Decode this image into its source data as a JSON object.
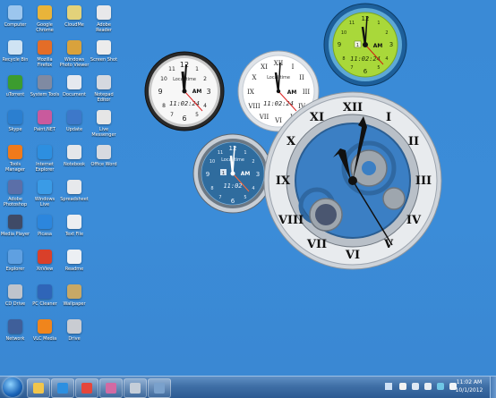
{
  "desktop": {
    "icons": [
      {
        "label": "Computer",
        "color": "#9cc6ee"
      },
      {
        "label": "Google Chrome",
        "color": "#e9b43a"
      },
      {
        "label": "CloudMe",
        "color": "#e3d27a"
      },
      {
        "label": "Adobe Reader",
        "color": "#e8e8ea"
      },
      {
        "label": "Recycle Bin",
        "color": "#cfe3f3"
      },
      {
        "label": "Mozilla Firefox",
        "color": "#e46d27"
      },
      {
        "label": "Windows Photo Viewer",
        "color": "#d9a23c"
      },
      {
        "label": "Screen Shot",
        "color": "#ececec"
      },
      {
        "label": "uTorrent",
        "color": "#3c9c2f"
      },
      {
        "label": "System Tools",
        "color": "#7f8aa2"
      },
      {
        "label": "Document",
        "color": "#e6e9ef"
      },
      {
        "label": "Notepad Editor",
        "color": "#d5d9e0"
      },
      {
        "label": "Skype",
        "color": "#2b7fd0"
      },
      {
        "label": "Paint.NET",
        "color": "#c95a9d"
      },
      {
        "label": "Update",
        "color": "#3d78c9"
      },
      {
        "label": "Live Messenger",
        "color": "#e6e6e6"
      },
      {
        "label": "Tools Manager",
        "color": "#f07a1a"
      },
      {
        "label": "Internet Explorer",
        "color": "#2d8fe0"
      },
      {
        "label": "Notebook",
        "color": "#e5e7ea"
      },
      {
        "label": "Office Word",
        "color": "#d7dae0"
      },
      {
        "label": "Adobe Photoshop",
        "color": "#5b6fa8"
      },
      {
        "label": "Windows Live",
        "color": "#3a9be6"
      },
      {
        "label": "Spreadsheet",
        "color": "#e7e9ec"
      },
      {
        "label": "Media Player",
        "color": "#3f4a66"
      },
      {
        "label": "Picasa",
        "color": "#2c86dd"
      },
      {
        "label": "Text File",
        "color": "#eceef1"
      },
      {
        "label": "Explorer",
        "color": "#5fa0e1"
      },
      {
        "label": "XnView",
        "color": "#d9402a"
      },
      {
        "label": "Readme",
        "color": "#eceff3"
      },
      {
        "label": "CD Drive",
        "color": "#bfc4cc"
      },
      {
        "label": "PC Cleaner",
        "color": "#2f65b8"
      },
      {
        "label": "Wallpaper",
        "color": "#c7a866"
      },
      {
        "label": "Network",
        "color": "#3f5f9a"
      },
      {
        "label": "VLC Media",
        "color": "#f0851c"
      },
      {
        "label": "Drive",
        "color": "#c9ccd2"
      }
    ]
  },
  "clocks": [
    {
      "name": "Local time",
      "ampm": "AM",
      "time": "11:02:24",
      "day": "",
      "style": "black"
    },
    {
      "name": "Local time",
      "ampm": "AM",
      "time": "11:02:24",
      "day": "",
      "style": "white"
    },
    {
      "name": "",
      "ampm": "AM",
      "time": "11:02:24",
      "day": "1",
      "style": "green"
    },
    {
      "name": "Local time",
      "ampm": "AM",
      "time": "11:02",
      "day": "1",
      "style": "blue"
    },
    {
      "name": "",
      "ampm": "",
      "time": "",
      "day": "",
      "style": "steampunk"
    }
  ],
  "taskbar": {
    "time": "11:02 AM",
    "date": "10/1/2012",
    "pinned": [
      {
        "name": "explorer",
        "color": "#f1c54b"
      },
      {
        "name": "internet-explorer",
        "color": "#2d8fe0"
      },
      {
        "name": "chrome",
        "color": "#e5463b"
      },
      {
        "name": "paint",
        "color": "#d26aa3"
      },
      {
        "name": "snipping-tool",
        "color": "#c5ced9"
      },
      {
        "name": "gadgets",
        "color": "#7aa1cc"
      }
    ]
  }
}
